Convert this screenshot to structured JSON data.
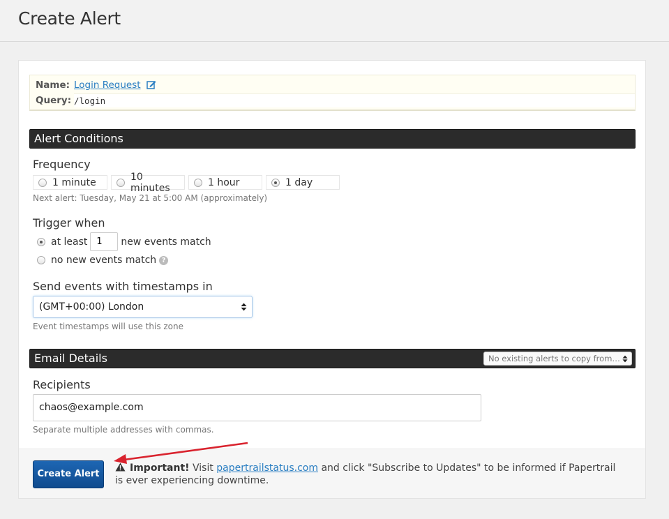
{
  "page": {
    "title": "Create Alert"
  },
  "search": {
    "name_label": "Name:",
    "name_value": "Login Request",
    "query_label": "Query:",
    "query_value": "/login"
  },
  "conditions": {
    "section_title": "Alert Conditions",
    "frequency": {
      "label": "Frequency",
      "options": [
        "1 minute",
        "10 minutes",
        "1 hour",
        "1 day"
      ],
      "selected": "1 day",
      "next_alert": "Next alert: Tuesday, May 21 at 5:00 AM (approximately)"
    },
    "trigger": {
      "label": "Trigger when",
      "at_least_prefix": "at least",
      "count_value": "1",
      "at_least_suffix": "new events match",
      "no_new_label": "no new events match",
      "selected": "at least"
    },
    "timezone": {
      "label": "Send events with timestamps in",
      "selected": "(GMT+00:00) London",
      "hint": "Event timestamps will use this zone"
    }
  },
  "email": {
    "section_title": "Email Details",
    "copy_select": "No existing alerts to copy from…",
    "recipients_label": "Recipients",
    "recipients_value": "chaos@example.com",
    "recipients_hint": "Separate multiple addresses with commas."
  },
  "footer": {
    "create_button": "Create Alert",
    "important": "Important!",
    "visit": "Visit",
    "status_link": "papertrailstatus.com",
    "message": "and click \"Subscribe to Updates\" to be informed if Papertrail is ever experiencing downtime."
  },
  "colors": {
    "primary_button": "#1d66b3",
    "section_bar": "#2b2b2b",
    "link": "#2a7ec2",
    "annotation_arrow": "#d9232e"
  },
  "icons": [
    "edit-icon",
    "help-icon",
    "select-updown-icon",
    "warning-icon",
    "annotation-arrow"
  ]
}
